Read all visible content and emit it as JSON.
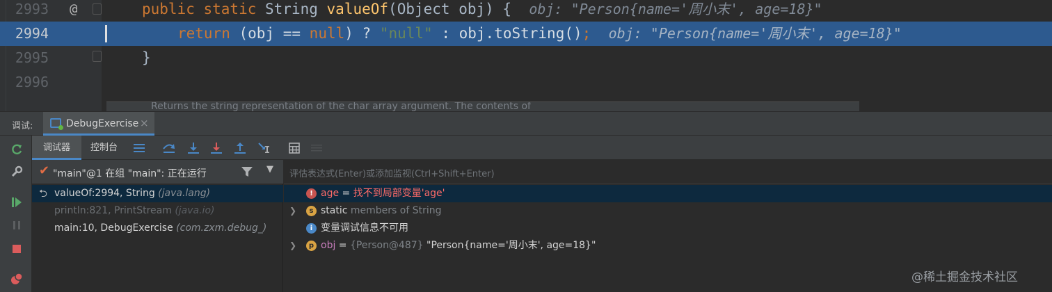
{
  "editor": {
    "lines": [
      {
        "num": "2993",
        "gutter_mark": "@",
        "k1": "public static ",
        "t1": "String ",
        "f1": "valueOf",
        "t2": "(Object obj) {",
        "hint": "obj: \"Person{name='周小末', age=18}\""
      },
      {
        "num": "2994",
        "k1": "return ",
        "t1": "(obj == ",
        "k2": "null",
        "t2": ") ? ",
        "s1": "\"null\"",
        "t3": " : obj.toString()",
        "k3": ";",
        "hint": "obj: \"Person{name='周小末', age=18}\""
      },
      {
        "num": "2995",
        "t1": "}"
      },
      {
        "num": "2996"
      }
    ],
    "tooltip_text": "Returns the string representation of the char array argument. The contents of"
  },
  "debug": {
    "label": "调试:",
    "tab_label": "DebugExercise",
    "tab_close": "×"
  },
  "toolbar": {
    "tab_debugger": "调试器",
    "tab_console": "控制台"
  },
  "frames": {
    "thread_label": "\"main\"@1 在组 \"main\": 正在运行",
    "items": [
      {
        "name": "valueOf:2994, String ",
        "pkg": "(java.lang)"
      },
      {
        "name": "println:821, PrintStream ",
        "pkg": "(java.io)"
      },
      {
        "name": "main:10, DebugExercise ",
        "pkg": "(com.zxm.debug_)"
      }
    ]
  },
  "variables": {
    "eval_placeholder": "评估表达式(Enter)或添加监视(Ctrl+Shift+Enter)",
    "items": [
      {
        "icon": "!",
        "name": "age",
        "eq": " = ",
        "value": "找不到局部变量'age'"
      },
      {
        "icon": "s",
        "name": "static",
        "value": " members of String"
      },
      {
        "icon": "i",
        "value": "变量调试信息不可用"
      },
      {
        "icon": "p",
        "name": "obj",
        "eq": " = ",
        "ref": "{Person@487} ",
        "value": "\"Person{name='周小末', age=18}\""
      }
    ]
  },
  "watermark": "@稀土掘金技术社区",
  "colors": {
    "accent": "#4a88c7",
    "selection": "#2d5a8f",
    "error": "#ff6b68",
    "keyword": "#cc7832"
  }
}
